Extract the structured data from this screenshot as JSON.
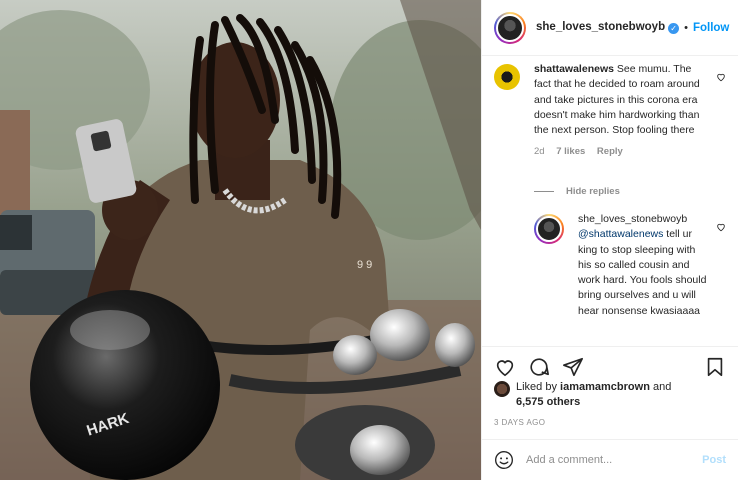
{
  "post": {
    "author": "she_loves_stonebwoyb",
    "follow_label": "Follow",
    "dot": "•",
    "photo_badge_text": "9 9",
    "helmet_text": "HARK"
  },
  "comments": [
    {
      "username": "shattawalenews",
      "text": "See mumu. The fact that he decided to roam around and take pictures in this corona era doesn't make him hardworking than the next person. Stop fooling there",
      "age": "2d",
      "likes": "7 likes",
      "reply_label": "Reply"
    }
  ],
  "hide_replies_label": "Hide replies",
  "replies": [
    {
      "username": "she_loves_stonebwoyb",
      "mention": "@shattawalenews",
      "text": "tell ur king to stop sleeping with his so called cousin and work hard. You fools should bring ourselves and u will hear nonsense kwasiaaaa"
    }
  ],
  "actions": {
    "like_icon": "heart-icon",
    "comment_icon": "comment-icon",
    "share_icon": "paper-plane-icon",
    "save_icon": "bookmark-icon"
  },
  "likes": {
    "prefix": "Liked by",
    "user": "iamamamcbrown",
    "joiner": "and",
    "count": "6,575 others"
  },
  "timestamp": "3 DAYS AGO",
  "composer": {
    "placeholder": "Add a comment...",
    "post_label": "Post"
  },
  "colors": {
    "link_blue": "#0095f6",
    "post_disabled": "#b2dffc",
    "meta_gray": "#8e8e8e"
  }
}
